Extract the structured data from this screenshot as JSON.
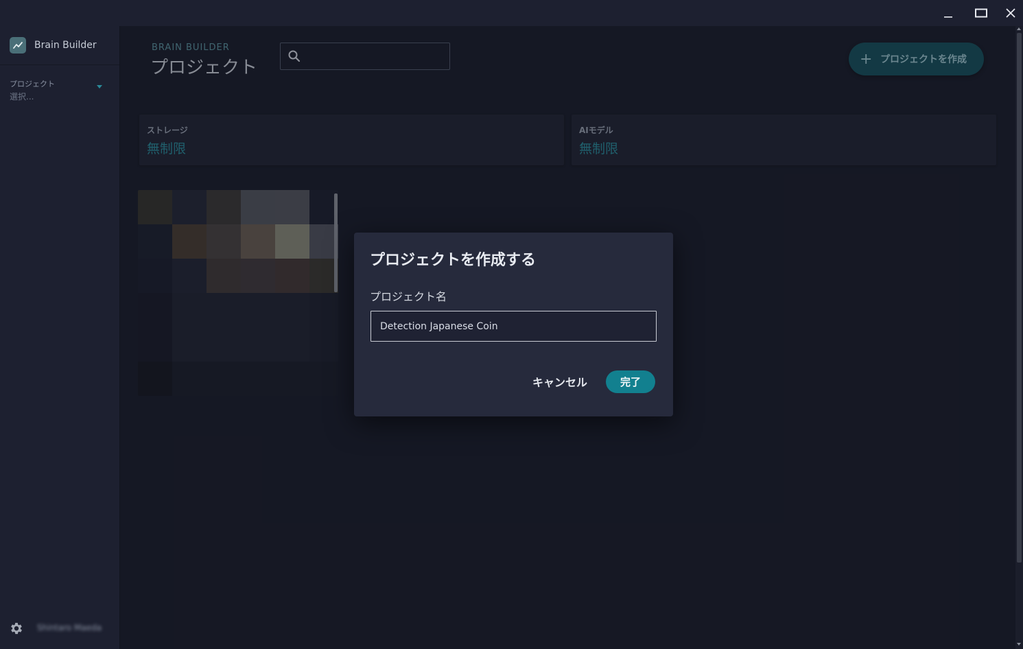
{
  "window": {
    "minimize_glyph": "_",
    "close_glyph": "✕"
  },
  "sidebar": {
    "app_name": "Brain Builder",
    "project_select": {
      "label": "プロジェクト",
      "placeholder": "選択..."
    },
    "user_name": "Shintaro Maeda"
  },
  "header": {
    "section_label": "BRAIN BUILDER",
    "title": "プロジェクト",
    "search_value": "",
    "create_button_label": "プロジェクトを作成",
    "create_button_icon": "plus-icon"
  },
  "stats": [
    {
      "label": "ストレージ",
      "value": "無制限"
    },
    {
      "label": "AIモデル",
      "value": "無制限"
    }
  ],
  "project_card": {
    "thumbnail": "pixelated-image",
    "mosaic_colors": [
      "#36352f",
      "#252938",
      "#3c3a38",
      "#54575f",
      "#55575f",
      "#1e2130",
      "#1e2230",
      "#4a3e33",
      "#4a4442",
      "#6b5e53",
      "#8b8a7a",
      "#52535f",
      "#1d202e",
      "#242736",
      "#433b3a",
      "#433b3e",
      "#463a38",
      "#3d3a34"
    ]
  },
  "dialog": {
    "title": "プロジェクトを作成する",
    "field_label": "プロジェクト名",
    "field_value": "Detection Japanese Coin",
    "cancel_label": "キャンセル",
    "confirm_label": "完了"
  },
  "colors": {
    "accent": "#12808f",
    "accent_text": "#2b8b9a",
    "background": "#1b1e2b",
    "dialog_bg": "#262a3c"
  }
}
